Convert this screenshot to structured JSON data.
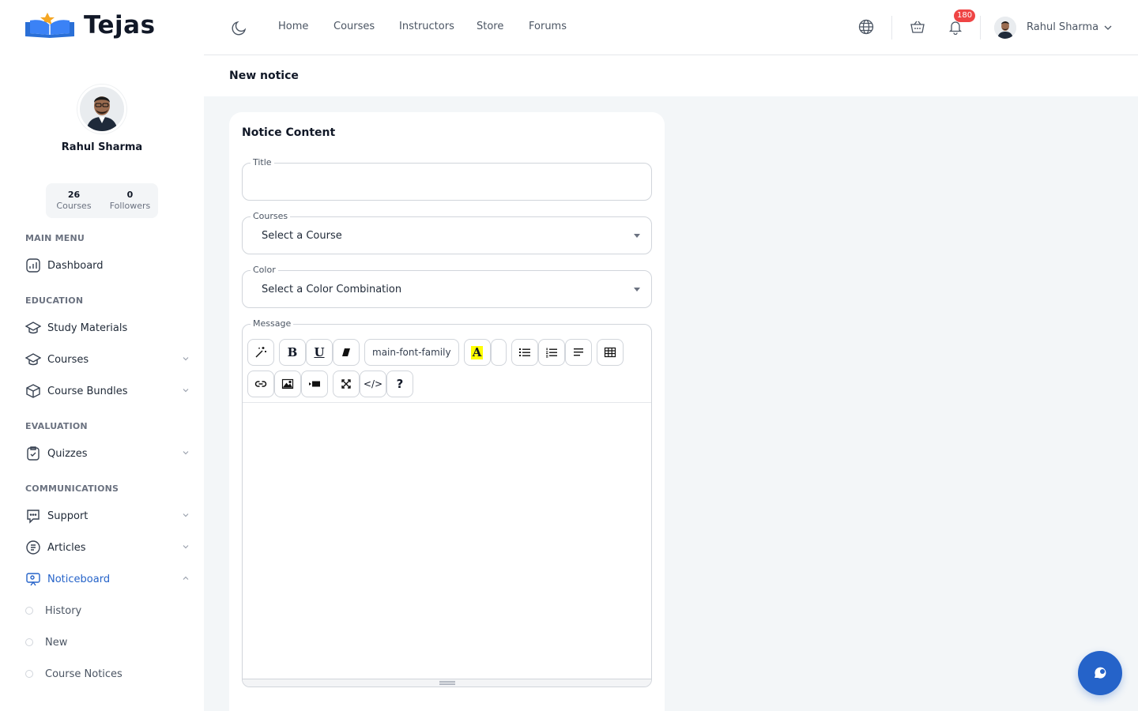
{
  "brand": {
    "name": "Tejas"
  },
  "profile": {
    "name": "Rahul Sharma",
    "stats": [
      {
        "value": "26",
        "label": "Courses"
      },
      {
        "value": "0",
        "label": "Followers"
      }
    ]
  },
  "sidebar": {
    "sections": {
      "main": "MAIN MENU",
      "education": "EDUCATION",
      "evaluation": "EVALUATION",
      "communications": "COMMUNICATIONS"
    },
    "items": {
      "dashboard": "Dashboard",
      "study_materials": "Study Materials",
      "courses": "Courses",
      "course_bundles": "Course Bundles",
      "quizzes": "Quizzes",
      "support": "Support",
      "articles": "Articles",
      "noticeboard": "Noticeboard"
    },
    "sub_items": {
      "history": "History",
      "new": "New",
      "course_notices": "Course Notices"
    }
  },
  "topnav": {
    "links": [
      "Home",
      "Courses",
      "Instructors",
      "Store",
      "Forums"
    ],
    "notification_count": "180",
    "user_name": "Rahul Sharma"
  },
  "page": {
    "title": "New notice"
  },
  "form": {
    "card_title": "Notice Content",
    "title_label": "Title",
    "title_value": "",
    "courses_label": "Courses",
    "courses_value": "Select a Course",
    "color_label": "Color",
    "color_value": "Select a Color Combination",
    "message_label": "Message",
    "font_family": "main-font-family",
    "bold_label": "B",
    "underline_label": "U",
    "highlight_label": "A",
    "help_label": "?",
    "code_label": "</>"
  },
  "colors": {
    "accent": "#2563c9",
    "badge": "#ef4444",
    "content_bg": "#f3f6f8"
  },
  "icons": {
    "chat": "chat-bubble-icon",
    "globe": "globe-icon",
    "cart": "basket-icon",
    "bell": "bell-icon",
    "moon": "moon-icon"
  }
}
